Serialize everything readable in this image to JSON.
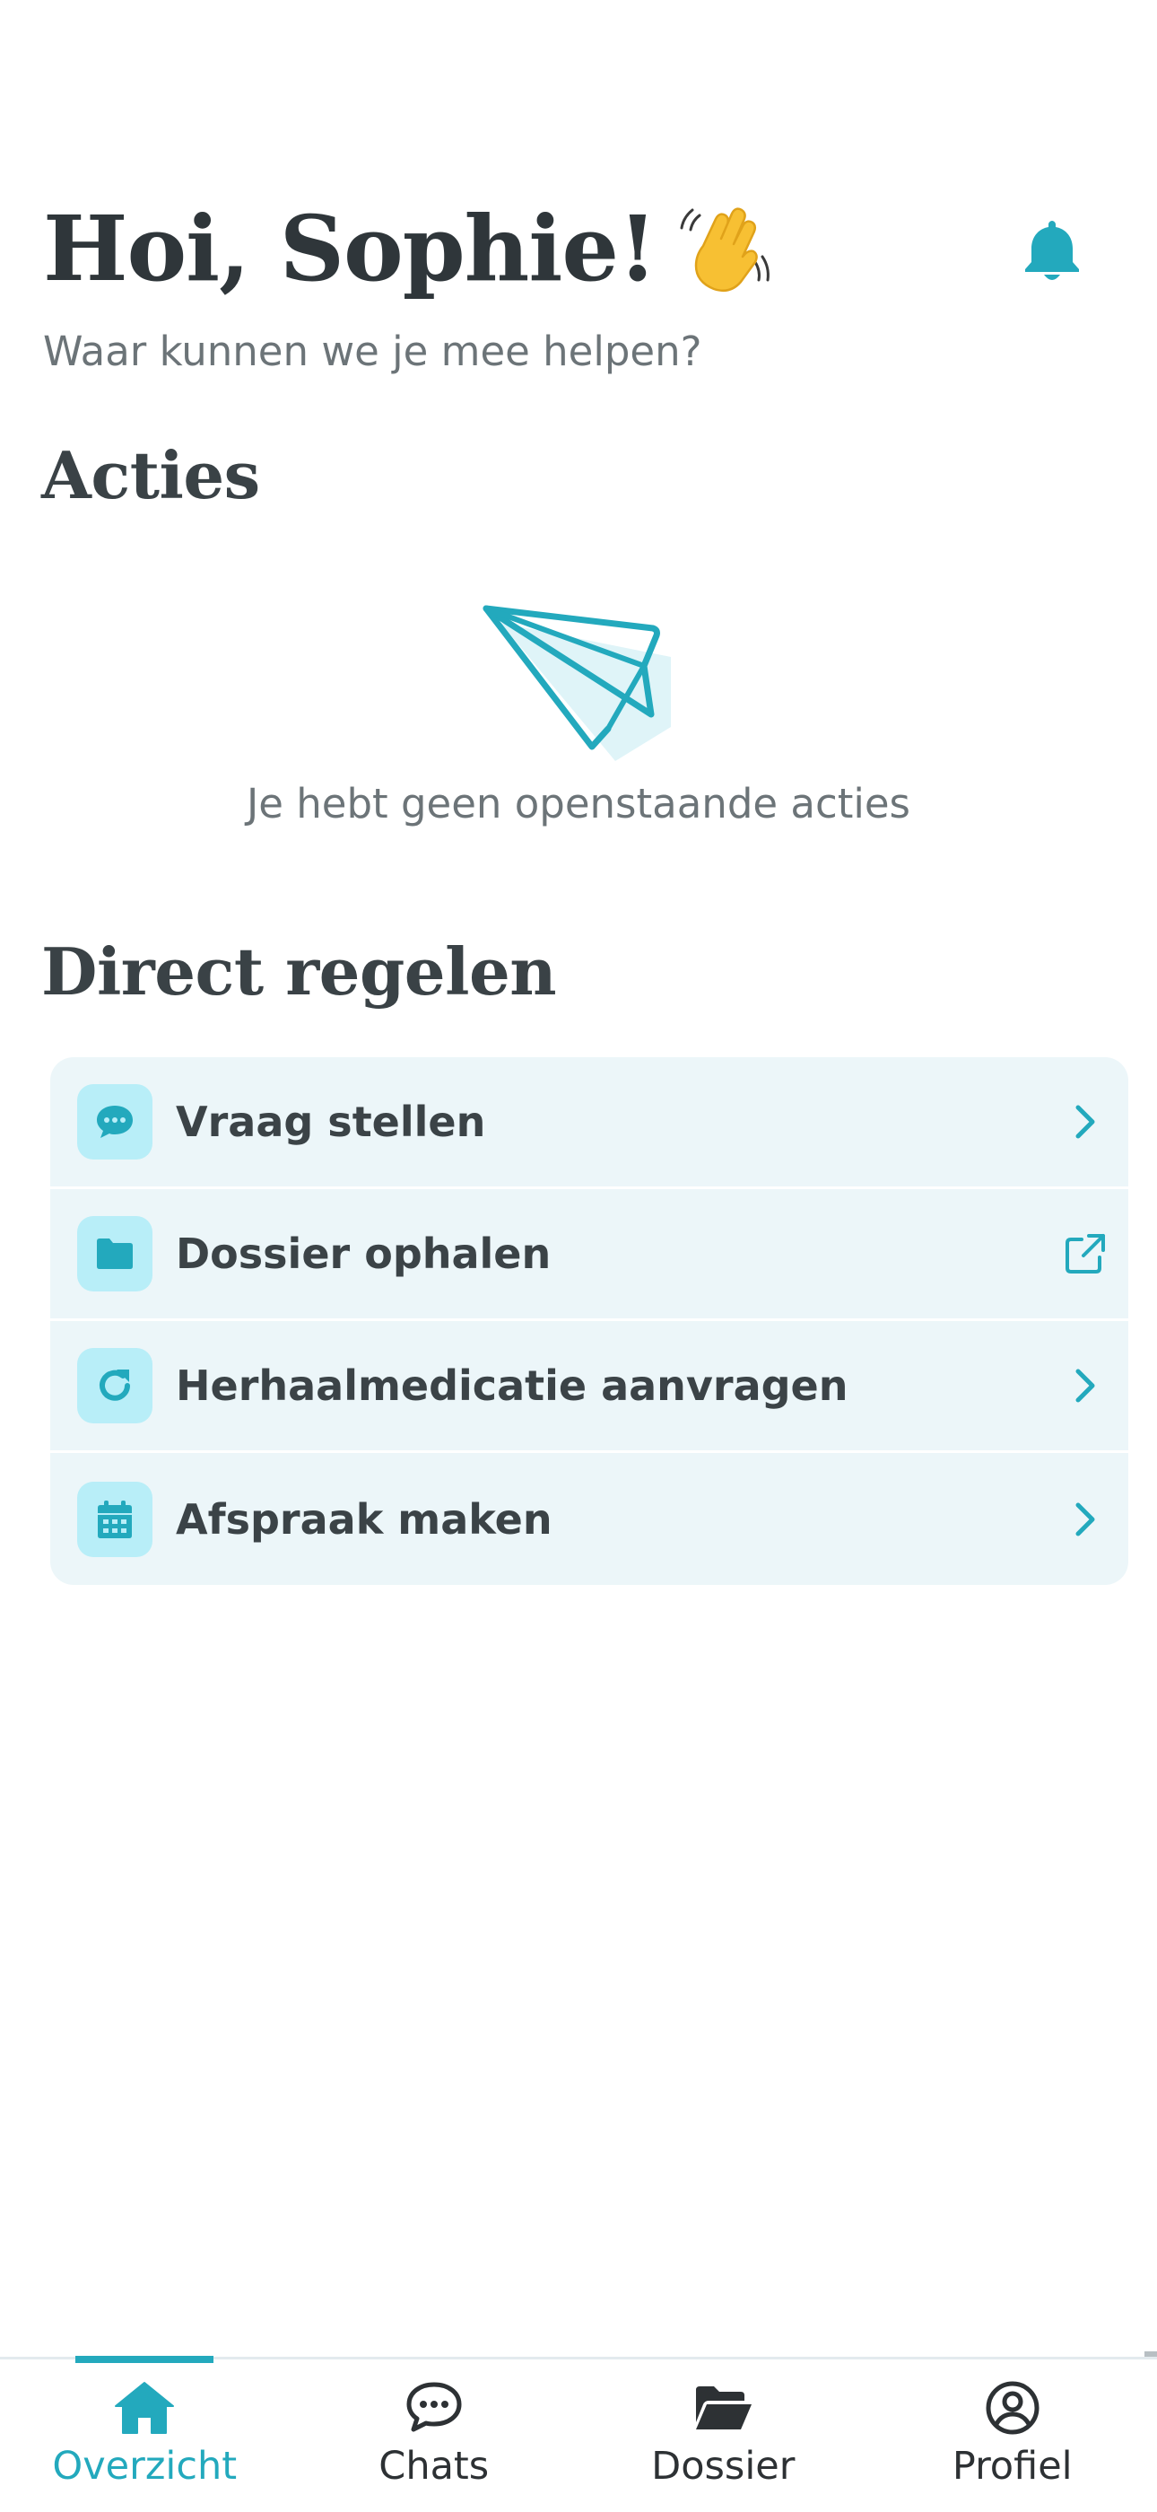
{
  "header": {
    "greeting": "Hoi, Sophie!",
    "subtitle": "Waar kunnen we je mee helpen?"
  },
  "actions": {
    "title": "Acties",
    "empty_text": "Je hebt geen openstaande acties"
  },
  "direct": {
    "title": "Direct regelen",
    "items": [
      {
        "label": "Vraag stellen",
        "icon": "chat-bubble-icon",
        "trail": "chevron-right-icon"
      },
      {
        "label": "Dossier ophalen",
        "icon": "folder-icon",
        "trail": "external-link-icon"
      },
      {
        "label": "Herhaalmedicatie aanvragen",
        "icon": "refresh-icon",
        "trail": "chevron-right-icon"
      },
      {
        "label": "Afspraak maken",
        "icon": "calendar-icon",
        "trail": "chevron-right-icon"
      }
    ]
  },
  "nav": {
    "items": [
      {
        "label": "Overzicht",
        "icon": "home-icon",
        "active": true
      },
      {
        "label": "Chats",
        "icon": "chats-icon",
        "active": false
      },
      {
        "label": "Dossier",
        "icon": "folder-open-icon",
        "active": false
      },
      {
        "label": "Profiel",
        "icon": "user-circle-icon",
        "active": false
      }
    ]
  },
  "colors": {
    "accent": "#23a9bd",
    "card_bg": "#ecf6f9",
    "icon_bg": "#b8eef8",
    "text_dark": "#2f363a",
    "text_muted": "#6c7478"
  }
}
